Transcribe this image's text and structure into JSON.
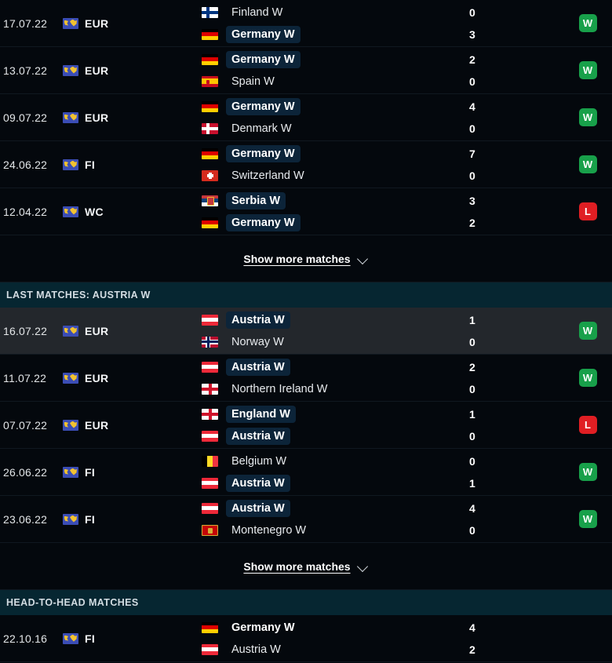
{
  "colors": {
    "background": "#04080d",
    "section_header_bg": "#062631",
    "winner_pill_bg": "#0c2439",
    "win_badge": "#18a04a",
    "loss_badge": "#e01e23",
    "row_hover_bg": "#23272c"
  },
  "sections": [
    {
      "id": "last-matches-germany",
      "header": null,
      "matches": [
        {
          "date": "17.07.22",
          "competition": "EUR",
          "competition_icon": "globe-icon",
          "home": {
            "name": "Finland W",
            "flag": "finland",
            "winner": false
          },
          "away": {
            "name": "Germany W",
            "flag": "germany",
            "winner": true
          },
          "home_score": "0",
          "away_score": "3",
          "result": "W",
          "hover": false
        },
        {
          "date": "13.07.22",
          "competition": "EUR",
          "competition_icon": "globe-icon",
          "home": {
            "name": "Germany W",
            "flag": "germany",
            "winner": true
          },
          "away": {
            "name": "Spain W",
            "flag": "spain",
            "winner": false
          },
          "home_score": "2",
          "away_score": "0",
          "result": "W",
          "hover": false
        },
        {
          "date": "09.07.22",
          "competition": "EUR",
          "competition_icon": "globe-icon",
          "home": {
            "name": "Germany W",
            "flag": "germany",
            "winner": true
          },
          "away": {
            "name": "Denmark W",
            "flag": "denmark",
            "winner": false
          },
          "home_score": "4",
          "away_score": "0",
          "result": "W",
          "hover": false
        },
        {
          "date": "24.06.22",
          "competition": "FI",
          "competition_icon": "globe-icon",
          "home": {
            "name": "Germany W",
            "flag": "germany",
            "winner": true
          },
          "away": {
            "name": "Switzerland W",
            "flag": "switzerland",
            "winner": false
          },
          "home_score": "7",
          "away_score": "0",
          "result": "W",
          "hover": false
        },
        {
          "date": "12.04.22",
          "competition": "WC",
          "competition_icon": "globe-icon",
          "home": {
            "name": "Serbia W",
            "flag": "serbia",
            "winner": true
          },
          "away": {
            "name": "Germany W",
            "flag": "germany",
            "winner": false,
            "highlight": true
          },
          "home_score": "3",
          "away_score": "2",
          "result": "L",
          "hover": false
        }
      ],
      "show_more": {
        "label": "Show more matches",
        "icon": "chevron-down-icon"
      }
    },
    {
      "id": "last-matches-austria",
      "header": "LAST MATCHES: AUSTRIA W",
      "matches": [
        {
          "date": "16.07.22",
          "competition": "EUR",
          "competition_icon": "globe-icon",
          "home": {
            "name": "Austria W",
            "flag": "austria",
            "winner": true
          },
          "away": {
            "name": "Norway W",
            "flag": "norway",
            "winner": false
          },
          "home_score": "1",
          "away_score": "0",
          "result": "W",
          "hover": true
        },
        {
          "date": "11.07.22",
          "competition": "EUR",
          "competition_icon": "globe-icon",
          "home": {
            "name": "Austria W",
            "flag": "austria",
            "winner": true
          },
          "away": {
            "name": "Northern Ireland W",
            "flag": "nireland",
            "winner": false
          },
          "home_score": "2",
          "away_score": "0",
          "result": "W",
          "hover": false
        },
        {
          "date": "07.07.22",
          "competition": "EUR",
          "competition_icon": "globe-icon",
          "home": {
            "name": "England W",
            "flag": "england",
            "winner": true
          },
          "away": {
            "name": "Austria W",
            "flag": "austria",
            "winner": false,
            "highlight": true
          },
          "home_score": "1",
          "away_score": "0",
          "result": "L",
          "hover": false
        },
        {
          "date": "26.06.22",
          "competition": "FI",
          "competition_icon": "globe-icon",
          "home": {
            "name": "Belgium W",
            "flag": "belgium",
            "winner": false
          },
          "away": {
            "name": "Austria W",
            "flag": "austria",
            "winner": true
          },
          "home_score": "0",
          "away_score": "1",
          "result": "W",
          "hover": false
        },
        {
          "date": "23.06.22",
          "competition": "FI",
          "competition_icon": "globe-icon",
          "home": {
            "name": "Austria W",
            "flag": "austria",
            "winner": true
          },
          "away": {
            "name": "Montenegro W",
            "flag": "montenegro",
            "winner": false
          },
          "home_score": "4",
          "away_score": "0",
          "result": "W",
          "hover": false
        }
      ],
      "show_more": {
        "label": "Show more matches",
        "icon": "chevron-down-icon"
      }
    },
    {
      "id": "head-to-head",
      "header": "HEAD-TO-HEAD MATCHES",
      "matches": [
        {
          "date": "22.10.16",
          "competition": "FI",
          "competition_icon": "globe-icon",
          "home": {
            "name": "Germany W",
            "flag": "germany",
            "winner": false,
            "bold": true
          },
          "away": {
            "name": "Austria W",
            "flag": "austria",
            "winner": false
          },
          "home_score": "4",
          "away_score": "2",
          "result": null,
          "hover": false
        }
      ],
      "show_more": null
    }
  ]
}
